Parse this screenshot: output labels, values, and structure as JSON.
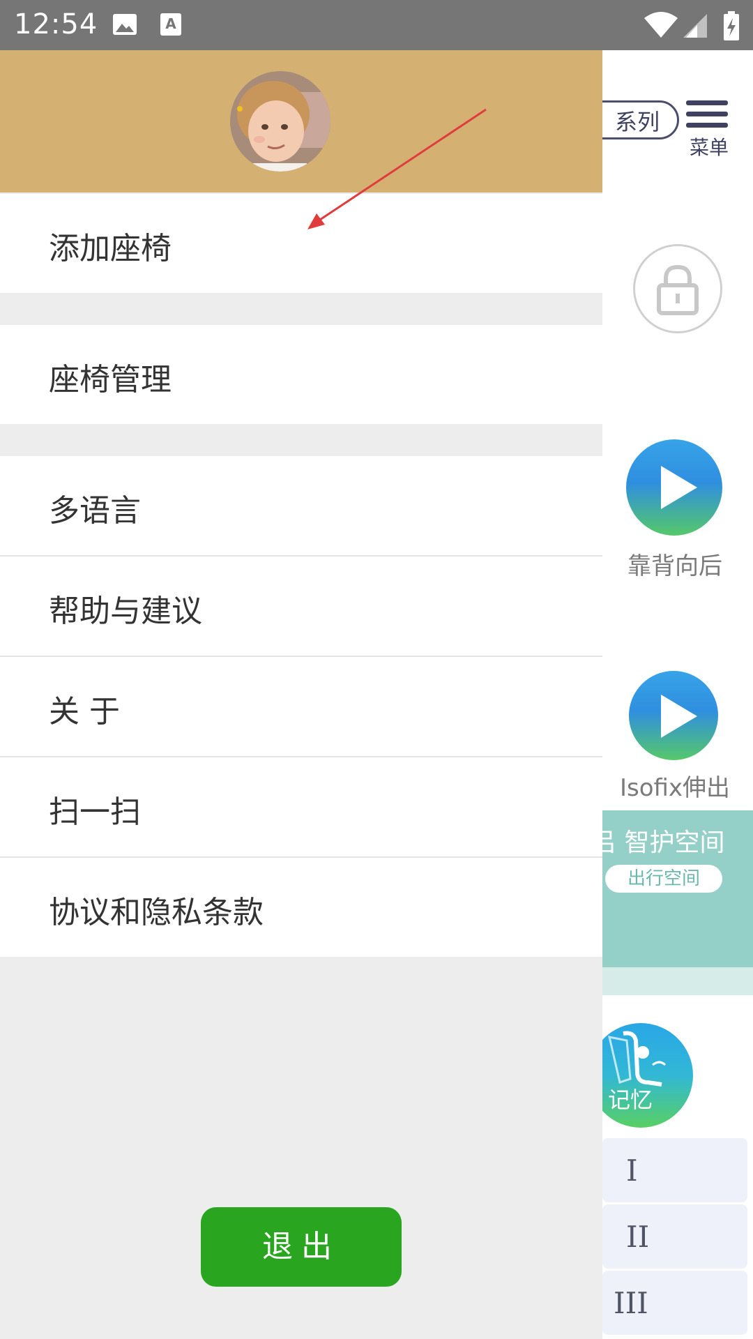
{
  "status_bar": {
    "time": "12:54"
  },
  "background_app": {
    "series_pill": "系列",
    "menu_label": "菜单",
    "video_items": [
      {
        "label": "靠背向后"
      },
      {
        "label": "Isofix伸出"
      }
    ],
    "banner_title": "智护空间",
    "banner_pill": "出行空间",
    "memory_label": "记忆",
    "levels": [
      "I",
      "II",
      "III"
    ]
  },
  "drawer": {
    "menu_items": [
      {
        "label": "添加座椅"
      },
      {
        "label": "座椅管理"
      },
      {
        "label": "多语言"
      },
      {
        "label": "帮助与建议"
      },
      {
        "label": "关 于"
      },
      {
        "label": "扫一扫"
      },
      {
        "label": "协议和隐私条款"
      }
    ],
    "logout_label": "退出"
  },
  "colors": {
    "header_bg": "#d4b173",
    "logout_bg": "#2aa520",
    "annotation_arrow": "#e03c3c"
  }
}
